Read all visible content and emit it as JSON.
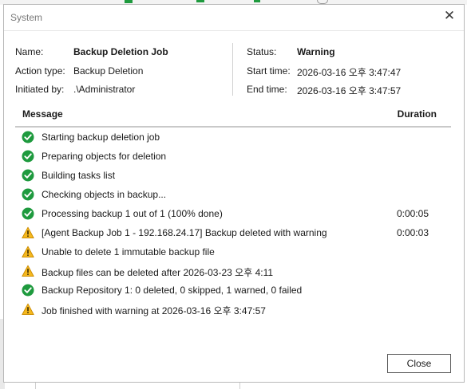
{
  "dialog": {
    "title": "System",
    "close_glyph": "✕",
    "close_button_label": "Close"
  },
  "info": {
    "name_label": "Name:",
    "name_value": "Backup Deletion Job",
    "action_label": "Action type:",
    "action_value": "Backup Deletion",
    "initiated_label": "Initiated by:",
    "initiated_value": ".\\Administrator",
    "status_label": "Status:",
    "status_value": "Warning",
    "start_label": "Start time:",
    "start_value": "2026-03-16 오후 3:47:47",
    "end_label": "End time:",
    "end_value": "2026-03-16 오후 3:47:57"
  },
  "table": {
    "col_message": "Message",
    "col_duration": "Duration",
    "rows": [
      {
        "icon": "success-check-icon",
        "message": "Starting backup deletion job",
        "duration": ""
      },
      {
        "icon": "success-check-icon",
        "message": "Preparing objects for deletion",
        "duration": ""
      },
      {
        "icon": "success-check-icon",
        "message": "Building tasks list",
        "duration": ""
      },
      {
        "icon": "success-check-icon",
        "message": "Checking objects in backup...",
        "duration": ""
      },
      {
        "icon": "success-check-icon",
        "message": "Processing backup 1 out of 1 (100% done)",
        "duration": "0:00:05"
      },
      {
        "icon": "warning-triangle-icon",
        "message": "[Agent Backup Job 1 - 192.168.24.17] Backup deleted with warning",
        "duration": "0:00:03"
      },
      {
        "icon": "warning-triangle-icon",
        "message": "Unable to delete 1 immutable backup file",
        "duration": ""
      },
      {
        "icon": "warning-triangle-icon",
        "message": "Backup files can be deleted after 2026-03-23 오후 4:11",
        "duration": ""
      },
      {
        "icon": "success-check-icon",
        "message": "Backup Repository 1: 0 deleted, 0 skipped, 1 warned, 0 failed",
        "duration": ""
      },
      {
        "icon": "warning-triangle-icon",
        "message": "Job finished with warning at 2026-03-16 오후 3:47:57",
        "duration": ""
      }
    ]
  },
  "colors": {
    "success": "#1e9a3e",
    "warning_fill": "#f5b81e",
    "warning_stroke": "#c98a00"
  }
}
